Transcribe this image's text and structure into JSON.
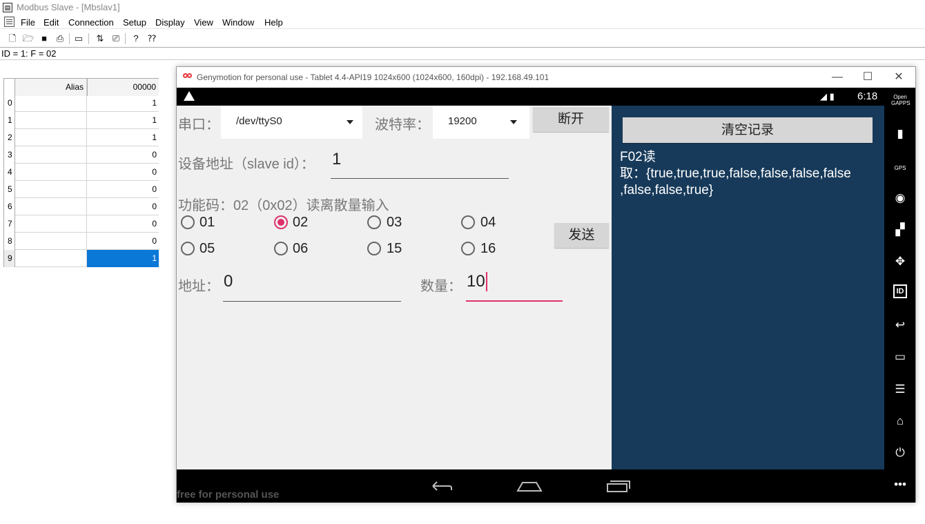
{
  "modbus": {
    "title": "Modbus Slave - [Mbslav1]",
    "menu": [
      "File",
      "Edit",
      "Connection",
      "Setup",
      "Display",
      "View",
      "Window",
      "Help"
    ],
    "id_line": "ID = 1: F = 02",
    "grid": {
      "header_alias": "Alias",
      "header_col": "00000",
      "rows": [
        {
          "index": "0",
          "value": "1"
        },
        {
          "index": "1",
          "value": "1"
        },
        {
          "index": "2",
          "value": "1"
        },
        {
          "index": "3",
          "value": "0"
        },
        {
          "index": "4",
          "value": "0"
        },
        {
          "index": "5",
          "value": "0"
        },
        {
          "index": "6",
          "value": "0"
        },
        {
          "index": "7",
          "value": "0"
        },
        {
          "index": "8",
          "value": "0"
        },
        {
          "index": "9",
          "value": "1"
        }
      ]
    }
  },
  "genymotion": {
    "title": "Genymotion for personal use - Tablet 4.4-API19 1024x600 (1024x600, 160dpi) - 192.168.49.101",
    "watermark": "free for personal use",
    "side_icons": [
      "opengapps-icon",
      "battery-icon",
      "gps-icon",
      "camera-icon",
      "clapper-icon",
      "move-icon",
      "id-icon",
      "back-icon",
      "recent-icon",
      "menu-icon",
      "home-icon",
      "power-icon",
      "more-icon"
    ],
    "side_opengapps_label": "Open GAPPS",
    "gps_label": "GPS",
    "id_label": "ID"
  },
  "android": {
    "clock": "6:18",
    "app": {
      "serial_label": "串口：",
      "serial_value": "/dev/ttyS0",
      "baud_label": "波特率：",
      "baud_value": "19200",
      "disconnect_button": "断开",
      "slave_label": "设备地址（slave id）：",
      "slave_value": "1",
      "func_label": "功能码：02（0x02）读离散量输入",
      "radios": [
        {
          "label": "01",
          "checked": false
        },
        {
          "label": "02",
          "checked": true
        },
        {
          "label": "03",
          "checked": false
        },
        {
          "label": "04",
          "checked": false
        },
        {
          "label": "05",
          "checked": false
        },
        {
          "label": "06",
          "checked": false
        },
        {
          "label": "15",
          "checked": false
        },
        {
          "label": "16",
          "checked": false
        }
      ],
      "send_button": "发送",
      "address_label": "地址：",
      "address_value": "0",
      "count_label": "数量：",
      "count_value": "10",
      "clear_button": "清空记录",
      "log_line1": "F02读",
      "log_line2": "取：{true,true,true,false,false,false,false",
      "log_line3": ",false,false,true}"
    }
  },
  "colors": {
    "accent": "#e0306c",
    "log_bg": "#173a5a",
    "selection": "#0a78d7"
  }
}
